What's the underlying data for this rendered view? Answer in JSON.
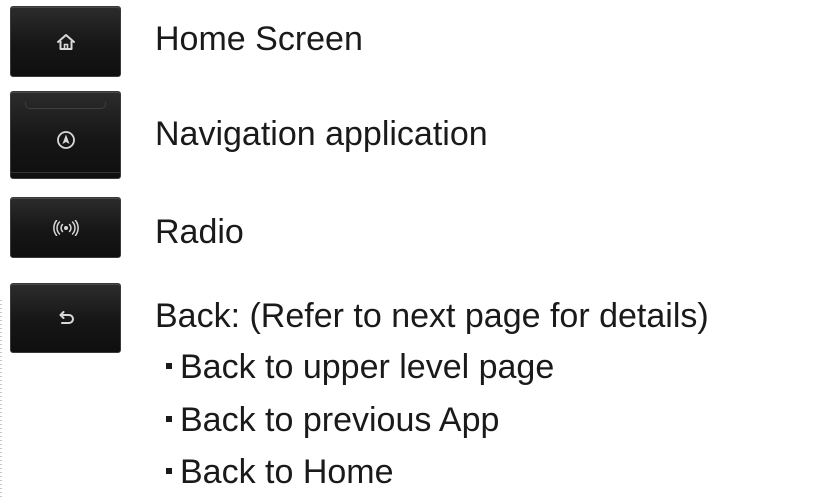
{
  "items": [
    {
      "icon": "home-icon",
      "label": "Home Screen"
    },
    {
      "icon": "navigation-compass-icon",
      "label": "Navigation application"
    },
    {
      "icon": "radio-broadcast-icon",
      "label": "Radio"
    },
    {
      "icon": "back-arrow-icon",
      "label": "Back: (Refer to next page for details)"
    }
  ],
  "back_details": [
    "Back to upper level page",
    "Back to previous App",
    "Back to Home"
  ],
  "colors": {
    "button_bg": "#161616",
    "icon": "#d8d8d8",
    "text": "#1a1a1a"
  }
}
